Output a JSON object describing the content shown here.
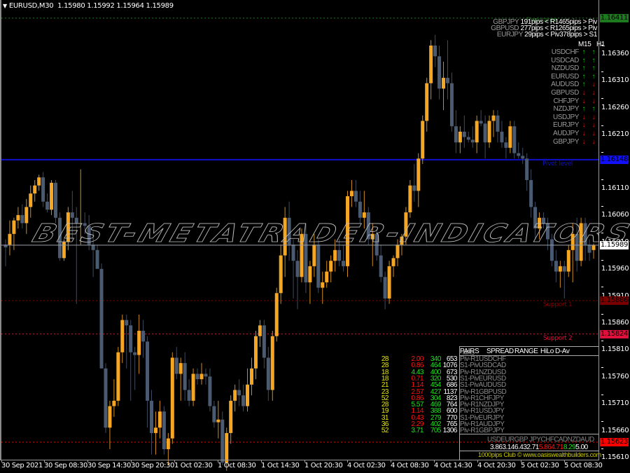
{
  "window": {
    "symbol_title": "EURUSD,M30",
    "ohlc": "1.15980 1.15992 1.15964 1.15989"
  },
  "colors": {
    "bull": "#f5a623",
    "bear": "#4a5a70",
    "pivot": "#1010cc",
    "support1": "#8b0000",
    "support2": "#e0103c",
    "support3": "#ff0000",
    "resistance": "#1e7a1e",
    "bid_line": "#9aa0a8",
    "up_arrow": "#00e000",
    "down_arrow": "#ff1010"
  },
  "price_axis": {
    "labels": [
      "1.16360",
      "1.16310",
      "1.16260",
      "1.16210",
      "1.16160",
      "1.16110",
      "1.16060",
      "1.16010",
      "1.15960",
      "1.15910",
      "1.15860",
      "1.15810",
      "1.15760",
      "1.15710",
      "1.15660",
      "1.15610"
    ],
    "tags": [
      {
        "name": "resistance-price-tag",
        "value": "1.16411",
        "bg": "#1e7a1e",
        "fg": "#000"
      },
      {
        "name": "pivot-price-tag",
        "value": "1.16148",
        "bg": "#1010ff",
        "fg": "#000"
      },
      {
        "name": "bid-price-tag",
        "value": "1.15989",
        "bg": "#ffffff",
        "fg": "#000"
      },
      {
        "name": "support1-price-tag",
        "value": "1.15886",
        "bg": "#7a0000",
        "fg": "#000"
      },
      {
        "name": "support2-price-tag",
        "value": "1.15824",
        "bg": "#e0103c",
        "fg": "#000"
      },
      {
        "name": "support3-price-tag",
        "value": "1.15623",
        "bg": "#ff0000",
        "fg": "#000"
      }
    ]
  },
  "time_axis": {
    "labels": [
      "30 Sep 2021",
      "30 Sep 08:30",
      "30 Sep 14:30",
      "30 Sep 20:30",
      "1 Oct 02:30",
      "1 Oct 08:30",
      "1 Oct 14:30",
      "1 Oct 20:30",
      "4 Oct 02:30",
      "4 Oct 08:30",
      "4 Oct 14:30",
      "4 Oct 20:30",
      "5 Oct 02:30",
      "5 Oct 08:30"
    ]
  },
  "levels": {
    "pivot_label": "Pivot level",
    "support1_label": "Support 1",
    "support2_label": "Support 2",
    "pivot": 1.16148,
    "support1": 1.15886,
    "support2": 1.15824,
    "support3": 1.15623,
    "resistance": 1.16411,
    "bid": 1.15989
  },
  "watermark": "BEST-METATRADER-INDICATORS.COM",
  "pips_panel": {
    "ghost": "Resistance",
    "rows": [
      {
        "pair": "GBPJPY",
        "text": "191pips < R1465pips > Piv"
      },
      {
        "pair": "GBPUSD",
        "text": "277pips < R1265pips > Piv"
      },
      {
        "pair": "EURJPY",
        "text": "29pips < Piv378pips > S1"
      }
    ]
  },
  "trend_panel": {
    "headers": [
      "M15",
      "H1"
    ],
    "rows": [
      {
        "pair": "USDCHF",
        "m15": "up",
        "h1": "up"
      },
      {
        "pair": "USDCAD",
        "m15": "up",
        "h1": "up"
      },
      {
        "pair": "NZDUSD",
        "m15": "up",
        "h1": "up"
      },
      {
        "pair": "EURUSD",
        "m15": "up",
        "h1": "up"
      },
      {
        "pair": "AUDUSD",
        "m15": "up",
        "h1": "down"
      },
      {
        "pair": "GBPUSD",
        "m15": "down",
        "h1": "down"
      },
      {
        "pair": "CHFJPY",
        "m15": "down",
        "h1": "down"
      },
      {
        "pair": "NZDJPY",
        "m15": "up",
        "h1": "up"
      },
      {
        "pair": "USDJPY",
        "m15": "down",
        "h1": "down"
      },
      {
        "pair": "EURJPY",
        "m15": "down",
        "h1": "down"
      },
      {
        "pair": "AUDJPY",
        "m15": "down",
        "h1": "down"
      },
      {
        "pair": "GBPJPY",
        "m15": "down",
        "h1": "down"
      }
    ]
  },
  "pairs_table": {
    "headers": [
      "PAIRS",
      "SPREAD",
      "RANGE",
      "HiLo",
      "D-Av"
    ],
    "header_overlay": "MRS",
    "rows": [
      {
        "level": "Piv-R1",
        "pair": "USDCHF",
        "spread": "28",
        "range": "2.00",
        "range_color": "#ff1010",
        "hilo": "340",
        "dav": "653"
      },
      {
        "level": "S1-Piv",
        "pair": "USDCAD",
        "spread": "28",
        "range": "0.86",
        "range_color": "#ff1010",
        "hilo": "464",
        "dav": "1076"
      },
      {
        "level": "Piv-R1",
        "pair": "NZDUSD",
        "spread": "18",
        "range": "4.43",
        "range_color": "#20e020",
        "hilo": "400",
        "dav": "673"
      },
      {
        "level": "S1-Piv",
        "pair": "EURUSD",
        "spread": "18",
        "range": "0.71",
        "range_color": "#ff1010",
        "hilo": "320",
        "dav": "530"
      },
      {
        "level": "S1-Piv",
        "pair": "AUDUSD",
        "spread": "21",
        "range": "1.14",
        "range_color": "#ff1010",
        "hilo": "454",
        "dav": "686"
      },
      {
        "level": "Piv-R1",
        "pair": "GBPUSD",
        "spread": "23",
        "range": "2.57",
        "range_color": "#ff1010",
        "hilo": "427",
        "dav": "1137"
      },
      {
        "level": "Piv-R1",
        "pair": "CHFJPY",
        "spread": "52",
        "range": "0.86",
        "range_color": "#ff1010",
        "hilo": "304",
        "dav": "823"
      },
      {
        "level": "Piv-R1",
        "pair": "NZDJPY",
        "spread": "28",
        "range": "5.57",
        "range_color": "#20e020",
        "hilo": "469",
        "dav": "764"
      },
      {
        "level": "Piv-R1",
        "pair": "USDJPY",
        "spread": "19",
        "range": "1.14",
        "range_color": "#ff1010",
        "hilo": "388",
        "dav": "600"
      },
      {
        "level": "S1-Piv",
        "pair": "EURJPY",
        "spread": "31",
        "range": "0.43",
        "range_color": "#ff1010",
        "hilo": "279",
        "dav": "770"
      },
      {
        "level": "Piv-R1",
        "pair": "AUDJPY",
        "spread": "36",
        "range": "2.29",
        "range_color": "#ff1010",
        "hilo": "402",
        "dav": "765"
      },
      {
        "level": "Piv-R1",
        "pair": "GBPJPY",
        "spread": "52",
        "range": "3.71",
        "range_color": "#20e020",
        "hilo": "705",
        "dav": "1306"
      }
    ]
  },
  "currency_strength": {
    "headers": "USDEURGBP JPYCHFCADNZDAUD",
    "values": [
      {
        "v": "3.86",
        "color": "#ffffff"
      },
      {
        "v": "3.14",
        "color": "#ffffff"
      },
      {
        "v": "6.43",
        "color": "#ffffff"
      },
      {
        "v": "2.71",
        "color": "#ffffff"
      },
      {
        "v": "5.86",
        "color": "#ff1010"
      },
      {
        "v": "4.71",
        "color": "#ff1010"
      },
      {
        "v": "8.29",
        "color": "#20e020"
      },
      {
        "v": "5.00",
        "color": "#ffffff"
      }
    ]
  },
  "footer": "1000pips Club © www.oasiswealthbuilders.com",
  "candles": [
    [
      1.1599,
      1.16,
      1.1595,
      1.15985
    ],
    [
      1.1599,
      1.16035,
      1.1597,
      1.1601
    ],
    [
      1.1601,
      1.1604,
      1.1598,
      1.16035
    ],
    [
      1.16035,
      1.1606,
      1.1602,
      1.16045
    ],
    [
      1.16045,
      1.16065,
      1.1602,
      1.1603
    ],
    [
      1.1603,
      1.16075,
      1.1601,
      1.1606
    ],
    [
      1.1606,
      1.161,
      1.1604,
      1.16085
    ],
    [
      1.16085,
      1.1611,
      1.1607,
      1.161
    ],
    [
      1.161,
      1.1612,
      1.1609,
      1.16115
    ],
    [
      1.16115,
      1.16125,
      1.1606,
      1.1607
    ],
    [
      1.1607,
      1.16085,
      1.1605,
      1.16055
    ],
    [
      1.16055,
      1.1611,
      1.16045,
      1.16105
    ],
    [
      1.16105,
      1.1611,
      1.1603,
      1.1604
    ],
    [
      1.1604,
      1.1605,
      1.1596,
      1.15965
    ],
    [
      1.15965,
      1.16,
      1.1596,
      1.15995
    ],
    [
      1.15995,
      1.1606,
      1.1598,
      1.1605
    ],
    [
      1.1605,
      1.1609,
      1.16,
      1.1604
    ],
    [
      1.1604,
      1.1606,
      1.1588,
      1.1603
    ],
    [
      1.1603,
      1.1613,
      1.1599,
      1.1603
    ],
    [
      1.1603,
      1.1605,
      1.1601,
      1.16025
    ],
    [
      1.16025,
      1.16045,
      1.1598,
      1.1599
    ],
    [
      1.1599,
      1.16015,
      1.1593,
      1.1598
    ],
    [
      1.1598,
      1.1599,
      1.1595,
      1.15945
    ],
    [
      1.15945,
      1.15955,
      1.1576,
      1.1576
    ],
    [
      1.1576,
      1.1577,
      1.1564,
      1.1565
    ],
    [
      1.1565,
      1.157,
      1.1561,
      1.1569
    ],
    [
      1.1569,
      1.1574,
      1.1567,
      1.157
    ],
    [
      1.157,
      1.158,
      1.1569,
      1.1579
    ],
    [
      1.1579,
      1.1586,
      1.1577,
      1.1585
    ],
    [
      1.1585,
      1.1586,
      1.1576,
      1.1584
    ],
    [
      1.1584,
      1.1585,
      1.157,
      1.1579
    ],
    [
      1.1579,
      1.158,
      1.1572,
      1.15785
    ],
    [
      1.15785,
      1.1586,
      1.1575,
      1.1583
    ],
    [
      1.1583,
      1.1585,
      1.1578,
      1.1581
    ],
    [
      1.1581,
      1.1582,
      1.1565,
      1.157
    ],
    [
      1.157,
      1.1572,
      1.156,
      1.1564
    ],
    [
      1.1564,
      1.1568,
      1.156,
      1.1565
    ],
    [
      1.1565,
      1.157,
      1.1563,
      1.1568
    ],
    [
      1.1568,
      1.1569,
      1.156,
      1.1561
    ],
    [
      1.1561,
      1.1564,
      1.1558,
      1.1563
    ],
    [
      1.1563,
      1.1579,
      1.1562,
      1.1578
    ],
    [
      1.1578,
      1.158,
      1.1574,
      1.1575
    ],
    [
      1.1575,
      1.1578,
      1.157,
      1.1577
    ],
    [
      1.1577,
      1.1579,
      1.157,
      1.1572
    ],
    [
      1.1572,
      1.1574,
      1.1569,
      1.157
    ],
    [
      1.157,
      1.1576,
      1.1569,
      1.1575
    ],
    [
      1.1575,
      1.1576,
      1.1573,
      1.1574
    ],
    [
      1.1574,
      1.1577,
      1.1573,
      1.1575
    ],
    [
      1.1575,
      1.1576,
      1.1573,
      1.15745
    ],
    [
      1.15745,
      1.1576,
      1.1568,
      1.1569
    ],
    [
      1.1569,
      1.157,
      1.1565,
      1.1566
    ],
    [
      1.1566,
      1.157,
      1.1563,
      1.15665
    ],
    [
      1.15665,
      1.1568,
      1.1558,
      1.15585
    ],
    [
      1.15585,
      1.1565,
      1.1557,
      1.1564
    ],
    [
      1.1564,
      1.1571,
      1.1562,
      1.157
    ],
    [
      1.157,
      1.1573,
      1.1568,
      1.1572
    ],
    [
      1.1572,
      1.1574,
      1.1569,
      1.1571
    ],
    [
      1.1571,
      1.1573,
      1.1568,
      1.1569
    ],
    [
      1.1569,
      1.1576,
      1.1568,
      1.1573
    ],
    [
      1.1573,
      1.1578,
      1.1571,
      1.1576
    ],
    [
      1.1576,
      1.1583,
      1.1574,
      1.1582
    ],
    [
      1.1582,
      1.1585,
      1.158,
      1.1584
    ],
    [
      1.1584,
      1.1585,
      1.1576,
      1.1578
    ],
    [
      1.1578,
      1.158,
      1.157,
      1.1572
    ],
    [
      1.1572,
      1.1583,
      1.157,
      1.1582
    ],
    [
      1.1582,
      1.1591,
      1.1581,
      1.159
    ],
    [
      1.159,
      1.1599,
      1.1588,
      1.1597
    ],
    [
      1.1597,
      1.1606,
      1.1593,
      1.1604
    ],
    [
      1.1604,
      1.1607,
      1.1596,
      1.1599
    ],
    [
      1.1599,
      1.16,
      1.1589,
      1.1596
    ],
    [
      1.1596,
      1.1598,
      1.1587,
      1.1593
    ],
    [
      1.1593,
      1.1602,
      1.1592,
      1.1601
    ],
    [
      1.1601,
      1.1603,
      1.159,
      1.1592
    ],
    [
      1.1592,
      1.1596,
      1.1588,
      1.1595
    ],
    [
      1.1595,
      1.1601,
      1.1593,
      1.1599
    ],
    [
      1.1599,
      1.16,
      1.159,
      1.1591
    ],
    [
      1.1591,
      1.1594,
      1.1588,
      1.1592
    ],
    [
      1.1592,
      1.1596,
      1.1591,
      1.1594
    ],
    [
      1.1594,
      1.1597,
      1.1592,
      1.1596
    ],
    [
      1.1596,
      1.16,
      1.1594,
      1.1598
    ],
    [
      1.1598,
      1.16,
      1.1595,
      1.1596
    ],
    [
      1.1596,
      1.1599,
      1.1594,
      1.1595
    ],
    [
      1.1595,
      1.1609,
      1.1593,
      1.1608
    ],
    [
      1.1608,
      1.1611,
      1.1606,
      1.1609
    ],
    [
      1.1609,
      1.1611,
      1.1606,
      1.1607
    ],
    [
      1.1607,
      1.1609,
      1.1603,
      1.1604
    ],
    [
      1.1604,
      1.1609,
      1.1602,
      1.1605
    ],
    [
      1.1605,
      1.1606,
      1.1599,
      1.16
    ],
    [
      1.16,
      1.1603,
      1.1595,
      1.1601
    ],
    [
      1.1601,
      1.1602,
      1.1596,
      1.1597
    ],
    [
      1.1597,
      1.1599,
      1.1592,
      1.1593
    ],
    [
      1.1593,
      1.1594,
      1.1587,
      1.1589
    ],
    [
      1.1589,
      1.1596,
      1.1588,
      1.1595
    ],
    [
      1.1595,
      1.1597,
      1.1593,
      1.15965
    ],
    [
      1.15965,
      1.16,
      1.1595,
      1.1599
    ],
    [
      1.1599,
      1.1601,
      1.1597,
      1.16005
    ],
    [
      1.16005,
      1.1606,
      1.1599,
      1.1605
    ],
    [
      1.1605,
      1.1611,
      1.1604,
      1.161
    ],
    [
      1.161,
      1.1614,
      1.1607,
      1.1609
    ],
    [
      1.1609,
      1.1616,
      1.1606,
      1.1615
    ],
    [
      1.1615,
      1.1623,
      1.1614,
      1.1622
    ],
    [
      1.1622,
      1.163,
      1.162,
      1.1629
    ],
    [
      1.1629,
      1.1637,
      1.1626,
      1.1636
    ],
    [
      1.1636,
      1.1638,
      1.1632,
      1.1634
    ],
    [
      1.1634,
      1.1636,
      1.1626,
      1.1628
    ],
    [
      1.1628,
      1.1633,
      1.1624,
      1.163
    ],
    [
      1.163,
      1.1637,
      1.1626,
      1.1629
    ],
    [
      1.1629,
      1.1631,
      1.162,
      1.1621
    ],
    [
      1.1621,
      1.1624,
      1.1616,
      1.1618
    ],
    [
      1.1618,
      1.1621,
      1.1616,
      1.162
    ],
    [
      1.162,
      1.1623,
      1.1617,
      1.1619
    ],
    [
      1.1619,
      1.162,
      1.1618,
      1.16185
    ],
    [
      1.16185,
      1.1621,
      1.1617,
      1.1618
    ],
    [
      1.1618,
      1.1623,
      1.1616,
      1.1622
    ],
    [
      1.1622,
      1.1624,
      1.1621,
      1.16215
    ],
    [
      1.16215,
      1.1623,
      1.1615,
      1.1618
    ],
    [
      1.1618,
      1.1623,
      1.1617,
      1.1622
    ],
    [
      1.1622,
      1.1624,
      1.1619,
      1.1623
    ],
    [
      1.1623,
      1.1624,
      1.1618,
      1.162
    ],
    [
      1.162,
      1.1622,
      1.1617,
      1.1618
    ],
    [
      1.1618,
      1.1619,
      1.1615,
      1.1617
    ],
    [
      1.1617,
      1.1622,
      1.1616,
      1.1621
    ],
    [
      1.1621,
      1.1622,
      1.1615,
      1.1616
    ],
    [
      1.1616,
      1.1618,
      1.1615,
      1.16155
    ],
    [
      1.16155,
      1.1617,
      1.1614,
      1.1615
    ],
    [
      1.1615,
      1.1616,
      1.1609,
      1.1611
    ],
    [
      1.1611,
      1.1613,
      1.1604,
      1.1606
    ],
    [
      1.1606,
      1.1607,
      1.16,
      1.1602
    ],
    [
      1.1602,
      1.1605,
      1.16,
      1.1604
    ],
    [
      1.1604,
      1.1605,
      1.1602,
      1.1603
    ],
    [
      1.1603,
      1.1604,
      1.1598,
      1.16
    ],
    [
      1.16,
      1.1601,
      1.1595,
      1.1596
    ],
    [
      1.1596,
      1.1598,
      1.1592,
      1.1594
    ],
    [
      1.1594,
      1.1596,
      1.1591,
      1.1595
    ],
    [
      1.1595,
      1.1596,
      1.1589,
      1.1594
    ],
    [
      1.1594,
      1.1599,
      1.1593,
      1.1598
    ],
    [
      1.1598,
      1.1603,
      1.1592,
      1.1601
    ],
    [
      1.1601,
      1.1604,
      1.1594,
      1.1596
    ],
    [
      1.1596,
      1.1604,
      1.1595,
      1.1603
    ],
    [
      1.1603,
      1.1604,
      1.1596,
      1.1599
    ],
    [
      1.1599,
      1.16,
      1.1596,
      1.15975
    ],
    [
      1.1598,
      1.15992,
      1.15964,
      1.15989
    ]
  ]
}
